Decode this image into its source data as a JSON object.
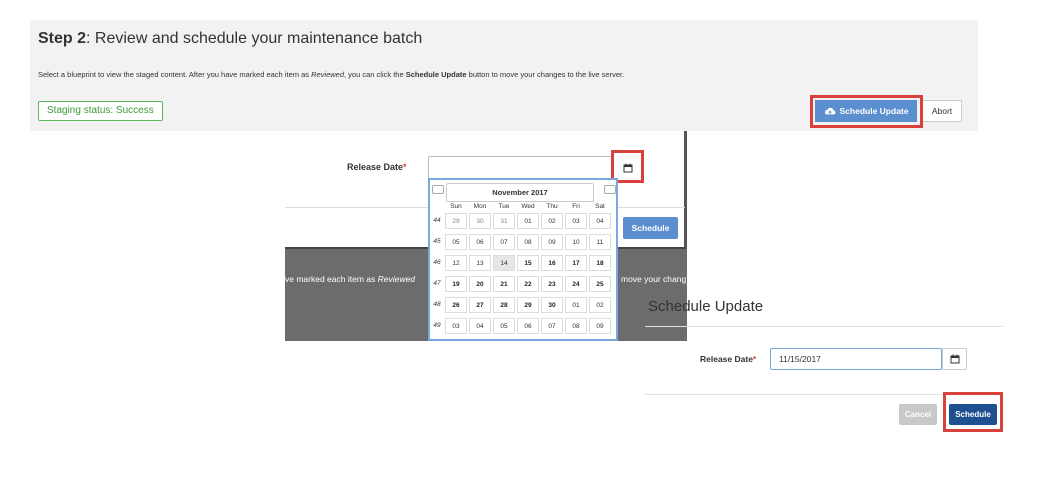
{
  "header": {
    "step_prefix": "Step 2",
    "step_rest": ": Review and schedule your maintenance batch",
    "instr_1": "Select a blueprint to view the staged content. After you have marked each item as ",
    "instr_reviewed": "Reviewed",
    "instr_2": ", you can click the ",
    "instr_bold": "Schedule Update",
    "instr_3": " button to move your changes to the live server.",
    "staging_status": "Staging status: Success",
    "schedule_update_label": "Schedule Update",
    "abort_label": "Abort"
  },
  "dialog_mid": {
    "release_label": "Release Date",
    "required_mark": "*",
    "schedule_label": "Schedule",
    "bg_text_left": "ve marked each item as ",
    "bg_text_italic": "Reviewed",
    "bg_text_right": "move your chang"
  },
  "calendar": {
    "month": "November 2017",
    "days_of_week": [
      "Sun",
      "Mon",
      "Tue",
      "Wed",
      "Thu",
      "Fri",
      "Sat"
    ],
    "weeks": [
      {
        "num": "44",
        "days": [
          "29",
          "30",
          "31",
          "01",
          "02",
          "03",
          "04"
        ],
        "style": [
          "muted",
          "muted",
          "muted",
          "",
          "",
          "",
          ""
        ]
      },
      {
        "num": "45",
        "days": [
          "05",
          "06",
          "07",
          "08",
          "09",
          "10",
          "11"
        ],
        "style": [
          "",
          "",
          "",
          "",
          "",
          "",
          ""
        ]
      },
      {
        "num": "46",
        "days": [
          "12",
          "13",
          "14",
          "15",
          "16",
          "17",
          "18"
        ],
        "style": [
          "",
          "",
          "today",
          "bold",
          "bold",
          "bold",
          "bold"
        ]
      },
      {
        "num": "47",
        "days": [
          "19",
          "20",
          "21",
          "22",
          "23",
          "24",
          "25"
        ],
        "style": [
          "bold",
          "bold",
          "bold",
          "bold",
          "bold",
          "bold",
          "bold"
        ]
      },
      {
        "num": "48",
        "days": [
          "26",
          "27",
          "28",
          "29",
          "30",
          "01",
          "02"
        ],
        "style": [
          "bold",
          "bold",
          "bold",
          "bold",
          "bold",
          "",
          ""
        ]
      },
      {
        "num": "49",
        "days": [
          "03",
          "04",
          "05",
          "06",
          "07",
          "08",
          "09"
        ],
        "style": [
          "",
          "",
          "",
          "",
          "",
          "",
          ""
        ]
      }
    ]
  },
  "dialog_br": {
    "title": "Schedule Update",
    "release_label": "Release Date",
    "required_mark": "*",
    "release_value": "11/15/2017",
    "cancel_label": "Cancel",
    "schedule_label": "Schedule"
  },
  "colors": {
    "highlight": "#d9413b",
    "primary_button": "#5b8fcf",
    "schedule_button": "#1d4f91",
    "success_green": "#3c9a3c"
  },
  "icons": {
    "cloud": "cloud-upload-icon",
    "calendar": "calendar-icon"
  }
}
